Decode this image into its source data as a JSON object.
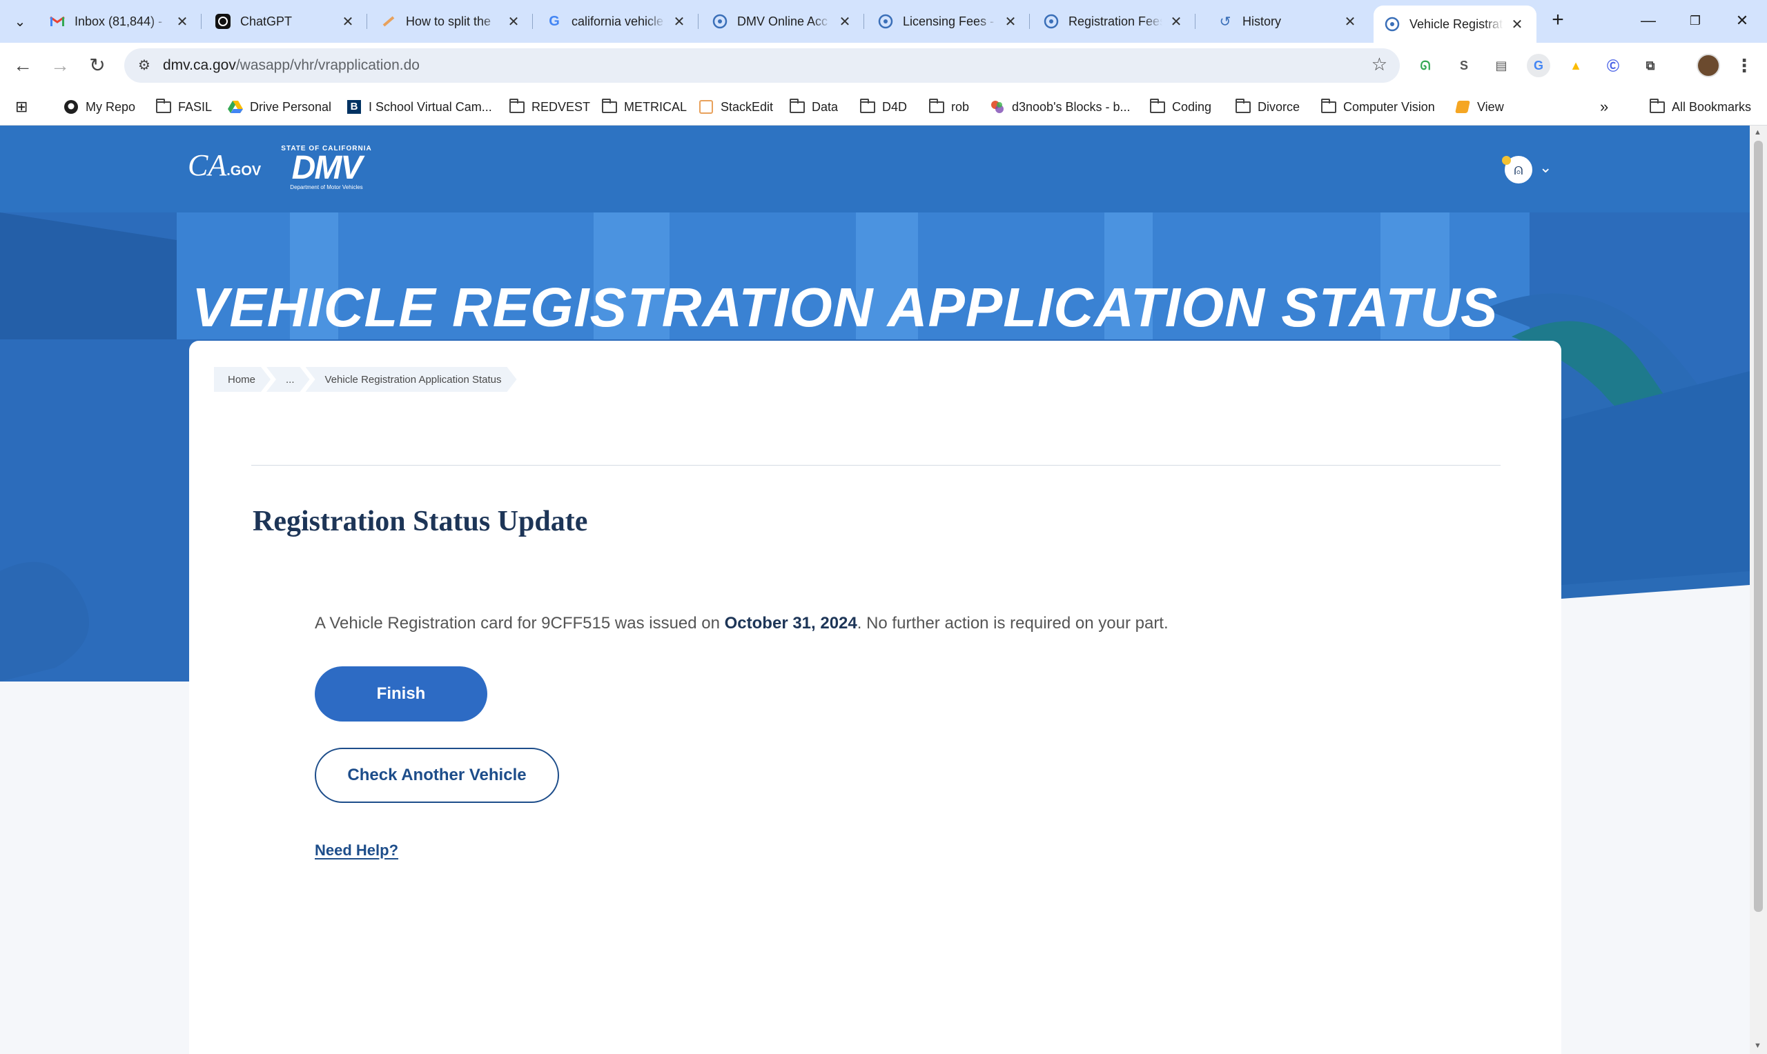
{
  "browser": {
    "tabs": [
      {
        "title": "Inbox (81,844) - ",
        "icon": "gmail-icon"
      },
      {
        "title": "ChatGPT",
        "icon": "chatgpt-icon"
      },
      {
        "title": "How to split the ",
        "icon": "stackedit-icon"
      },
      {
        "title": "california vehicle ",
        "icon": "google-icon"
      },
      {
        "title": "DMV Online Acc",
        "icon": "ca-gov-icon"
      },
      {
        "title": "Licensing Fees - ",
        "icon": "ca-gov-icon"
      },
      {
        "title": "Registration Fees",
        "icon": "ca-gov-icon"
      },
      {
        "title": "History",
        "icon": "history-icon"
      },
      {
        "title": "Vehicle Registrat",
        "icon": "ca-gov-icon",
        "active": true
      }
    ],
    "url_host": "dmv.ca.gov",
    "url_path": "/wasapp/vhr/vrapplication.do",
    "bookmarks": [
      {
        "label": "My Repo",
        "icon": "github-icon"
      },
      {
        "label": "FASIL",
        "icon": "folder-icon"
      },
      {
        "label": "Drive Personal",
        "icon": "google-drive-icon"
      },
      {
        "label": "I School Virtual Cam...",
        "icon": "berkeley-icon"
      },
      {
        "label": "REDVEST",
        "icon": "folder-icon"
      },
      {
        "label": "METRICAL",
        "icon": "folder-icon"
      },
      {
        "label": "StackEdit",
        "icon": "stackedit-icon"
      },
      {
        "label": "Data",
        "icon": "folder-icon"
      },
      {
        "label": "D4D",
        "icon": "folder-icon"
      },
      {
        "label": "rob",
        "icon": "folder-icon"
      },
      {
        "label": "d3noob's Blocks - b...",
        "icon": "d3-icon"
      },
      {
        "label": "Coding",
        "icon": "folder-icon"
      },
      {
        "label": "Divorce",
        "icon": "folder-icon"
      },
      {
        "label": "Computer Vision",
        "icon": "folder-icon"
      },
      {
        "label": "View",
        "icon": "view-icon"
      }
    ],
    "all_bookmarks": "All Bookmarks"
  },
  "site": {
    "ca_logo": "CA",
    "ca_logo_suffix": ".GOV",
    "dmv_state": "STATE OF CALIFORNIA",
    "dmv_mark": "DMV",
    "dmv_full": "Department of Motor Vehicles"
  },
  "hero": {
    "title": "VEHICLE REGISTRATION APPLICATION STATUS"
  },
  "breadcrumb": {
    "home": "Home",
    "ellipsis": "...",
    "current": "Vehicle Registration Application Status"
  },
  "content": {
    "heading": "Registration Status Update",
    "msg_prefix": "A Vehicle Registration card for 9CFF515 was issued on ",
    "msg_date": "October 31, 2024",
    "msg_suffix": ". No further action is required on your part.",
    "finish_label": "Finish",
    "check_label": "Check Another Vehicle",
    "help_label": "Need Help?"
  },
  "colors": {
    "header_blue": "#2d73c2",
    "brand_navy": "#1d3557",
    "button_blue": "#2d6bc4",
    "tab_strip": "#d3e3fd"
  }
}
